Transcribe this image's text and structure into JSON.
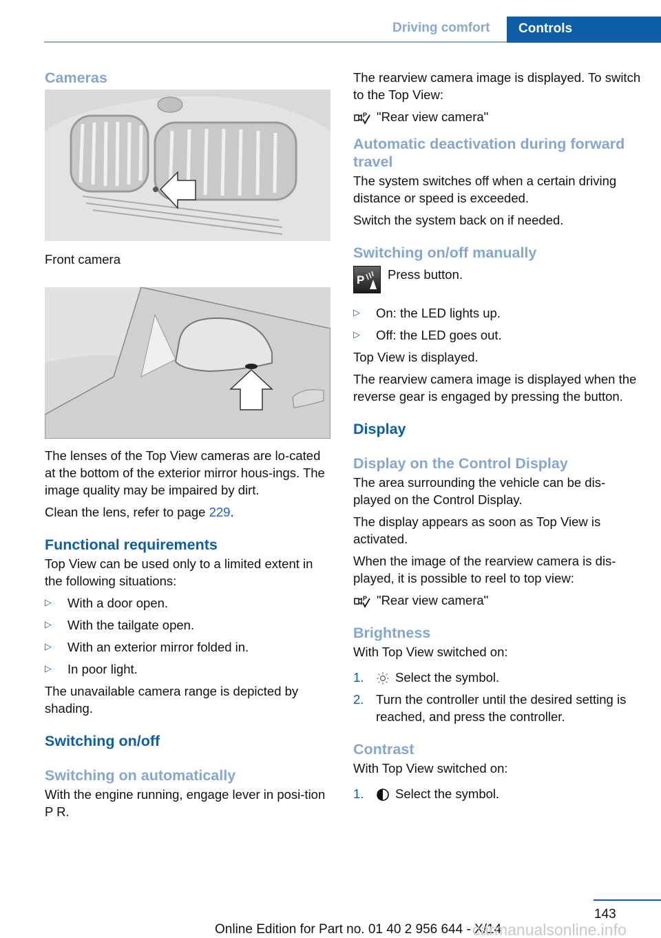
{
  "header": {
    "section": "Driving comfort",
    "tab": "Controls"
  },
  "left": {
    "cameras_heading": "Cameras",
    "fig1_caption": "Front camera",
    "lenses_text": "The lenses of the Top View cameras are lo-cated at the bottom of the exterior mirror hous-ings. The image quality may be impaired by dirt.",
    "clean_text_pre": "Clean the lens, refer to page ",
    "clean_link": "229",
    "clean_text_post": ".",
    "func_heading": "Functional requirements",
    "func_intro": "Top View can be used only to a limited extent in the following situations:",
    "func_items": [
      "With a door open.",
      "With the tailgate open.",
      "With an exterior mirror folded in.",
      "In poor light."
    ],
    "unavailable_text": "The unavailable camera range is depicted by shading.",
    "switch_heading": "Switching on/off",
    "auto_heading": "Switching on automatically",
    "auto_text": "With the engine running, engage lever in posi-tion P R."
  },
  "right": {
    "rear_text": "The rearview camera image is displayed. To switch to the Top View:",
    "rear_menu_1": "\"Rear view camera\"",
    "auto_deact_heading": "Automatic deactivation during forward travel",
    "auto_deact_text": "The system switches off when a certain driving distance or speed is exceeded.",
    "switch_back_text": "Switch the system back on if needed.",
    "manual_heading": "Switching on/off manually",
    "press_button": "Press button.",
    "led_items": [
      "On: the LED lights up.",
      "Off: the LED goes out."
    ],
    "topview_displayed": "Top View is displayed.",
    "reverse_text": "The rearview camera image is displayed when the reverse gear is engaged by pressing the button.",
    "display_heading": "Display",
    "control_display_heading": "Display on the Control Display",
    "area_text": "The area surrounding the vehicle can be dis-played on the Control Display.",
    "appears_text": "The display appears as soon as Top View is activated.",
    "reel_text": "When the image of the rearview camera is dis-played, it is possible to reel to top view:",
    "rear_menu_2": "\"Rear view camera\"",
    "brightness_heading": "Brightness",
    "brightness_intro": "With Top View switched on:",
    "brightness_steps": [
      {
        "num": "1.",
        "text": "Select the symbol."
      },
      {
        "num": "2.",
        "text": "Turn the controller until the desired setting is reached, and press the controller."
      }
    ],
    "contrast_heading": "Contrast",
    "contrast_intro": "With Top View switched on:",
    "contrast_steps": [
      {
        "num": "1.",
        "text": "Select the symbol."
      }
    ]
  },
  "footer": {
    "page_number": "143",
    "edition": "Online Edition for Part no. 01 40 2 956 644 - X/14",
    "watermark": "carmanualsonline.info"
  },
  "colors": {
    "accent_dark": "#0c5ea8",
    "accent_light": "#86a6d2",
    "link": "#1a5fd8"
  }
}
